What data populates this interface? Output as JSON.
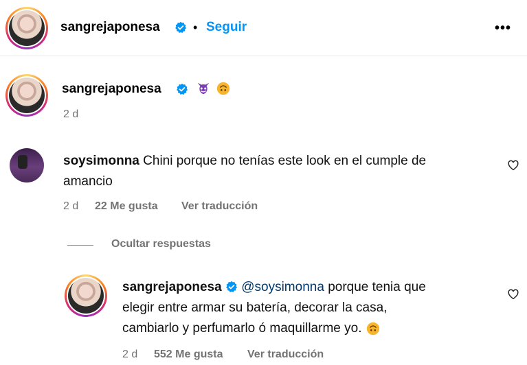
{
  "header": {
    "username": "sangrejaponesa",
    "separator": "•",
    "follow_label": "Seguir",
    "more_label": "•••"
  },
  "caption": {
    "username": "sangrejaponesa",
    "emojis": [
      "devil-face-emoji",
      "upside-down-smile-emoji"
    ],
    "time": "2 d"
  },
  "comment": {
    "username": "soysimonna",
    "text_line1": "Chini porque no tenías este look en el cumple de",
    "text_line2": "amancio",
    "time": "2 d",
    "likes": "22 Me gusta",
    "translate": "Ver traducción"
  },
  "replies_toggle": "Ocultar respuestas",
  "reply": {
    "username": "sangrejaponesa",
    "mention": "@soysimonna",
    "text_line1_rest": "porque tenia que",
    "text_line2": "elegir entre armar su batería, decorar la casa,",
    "text_line3": "cambiarlo y perfumarlo ó maquillarme yo.",
    "time": "2 d",
    "likes": "552 Me gusta",
    "translate": "Ver traducción"
  },
  "colors": {
    "verified": "#0095f6",
    "follow": "#0095f6",
    "mention": "#00376b",
    "meta": "#737373"
  }
}
